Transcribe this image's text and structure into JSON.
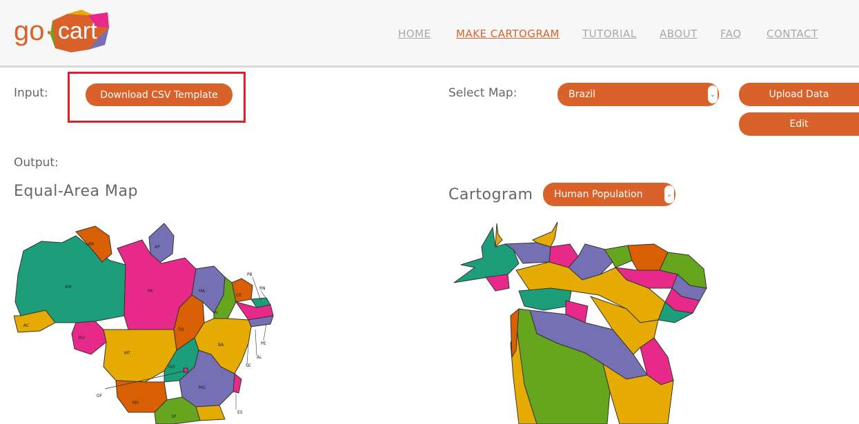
{
  "header": {
    "logo": {
      "prefix": "go·",
      "word": "cart"
    },
    "nav": [
      {
        "label": "HOME",
        "active": false
      },
      {
        "label": "MAKE CARTOGRAM",
        "active": true
      },
      {
        "label": "TUTORIAL",
        "active": false
      },
      {
        "label": "ABOUT",
        "active": false
      },
      {
        "label": "FAQ",
        "active": false
      },
      {
        "label": "CONTACT",
        "active": false
      }
    ]
  },
  "input": {
    "label": "Input:",
    "download_button": "Download CSV Template"
  },
  "select_map": {
    "label": "Select Map:",
    "value": "Brazil",
    "upload_button": "Upload Data",
    "edit_button": "Edit"
  },
  "output": {
    "label": "Output:",
    "equal_area_title": "Equal-Area Map",
    "cartogram_title": "Cartogram",
    "cartogram_variable": "Human Population"
  },
  "colors": {
    "accent": "#d9612a",
    "highlight_box": "#d8232a",
    "map_teal": "#1c9e7a",
    "map_orange": "#d95f02",
    "map_purple": "#7570b3",
    "map_pink": "#e7298a",
    "map_green": "#66a61e",
    "map_yellow": "#e6ab02"
  },
  "map_labels": [
    "RR",
    "AP",
    "AM",
    "PA",
    "MA",
    "CE",
    "RN",
    "PB",
    "PE",
    "AL",
    "SE",
    "BA",
    "PI",
    "TO",
    "AC",
    "RO",
    "MT",
    "GO",
    "DF",
    "MG",
    "ES",
    "MS",
    "SP"
  ]
}
